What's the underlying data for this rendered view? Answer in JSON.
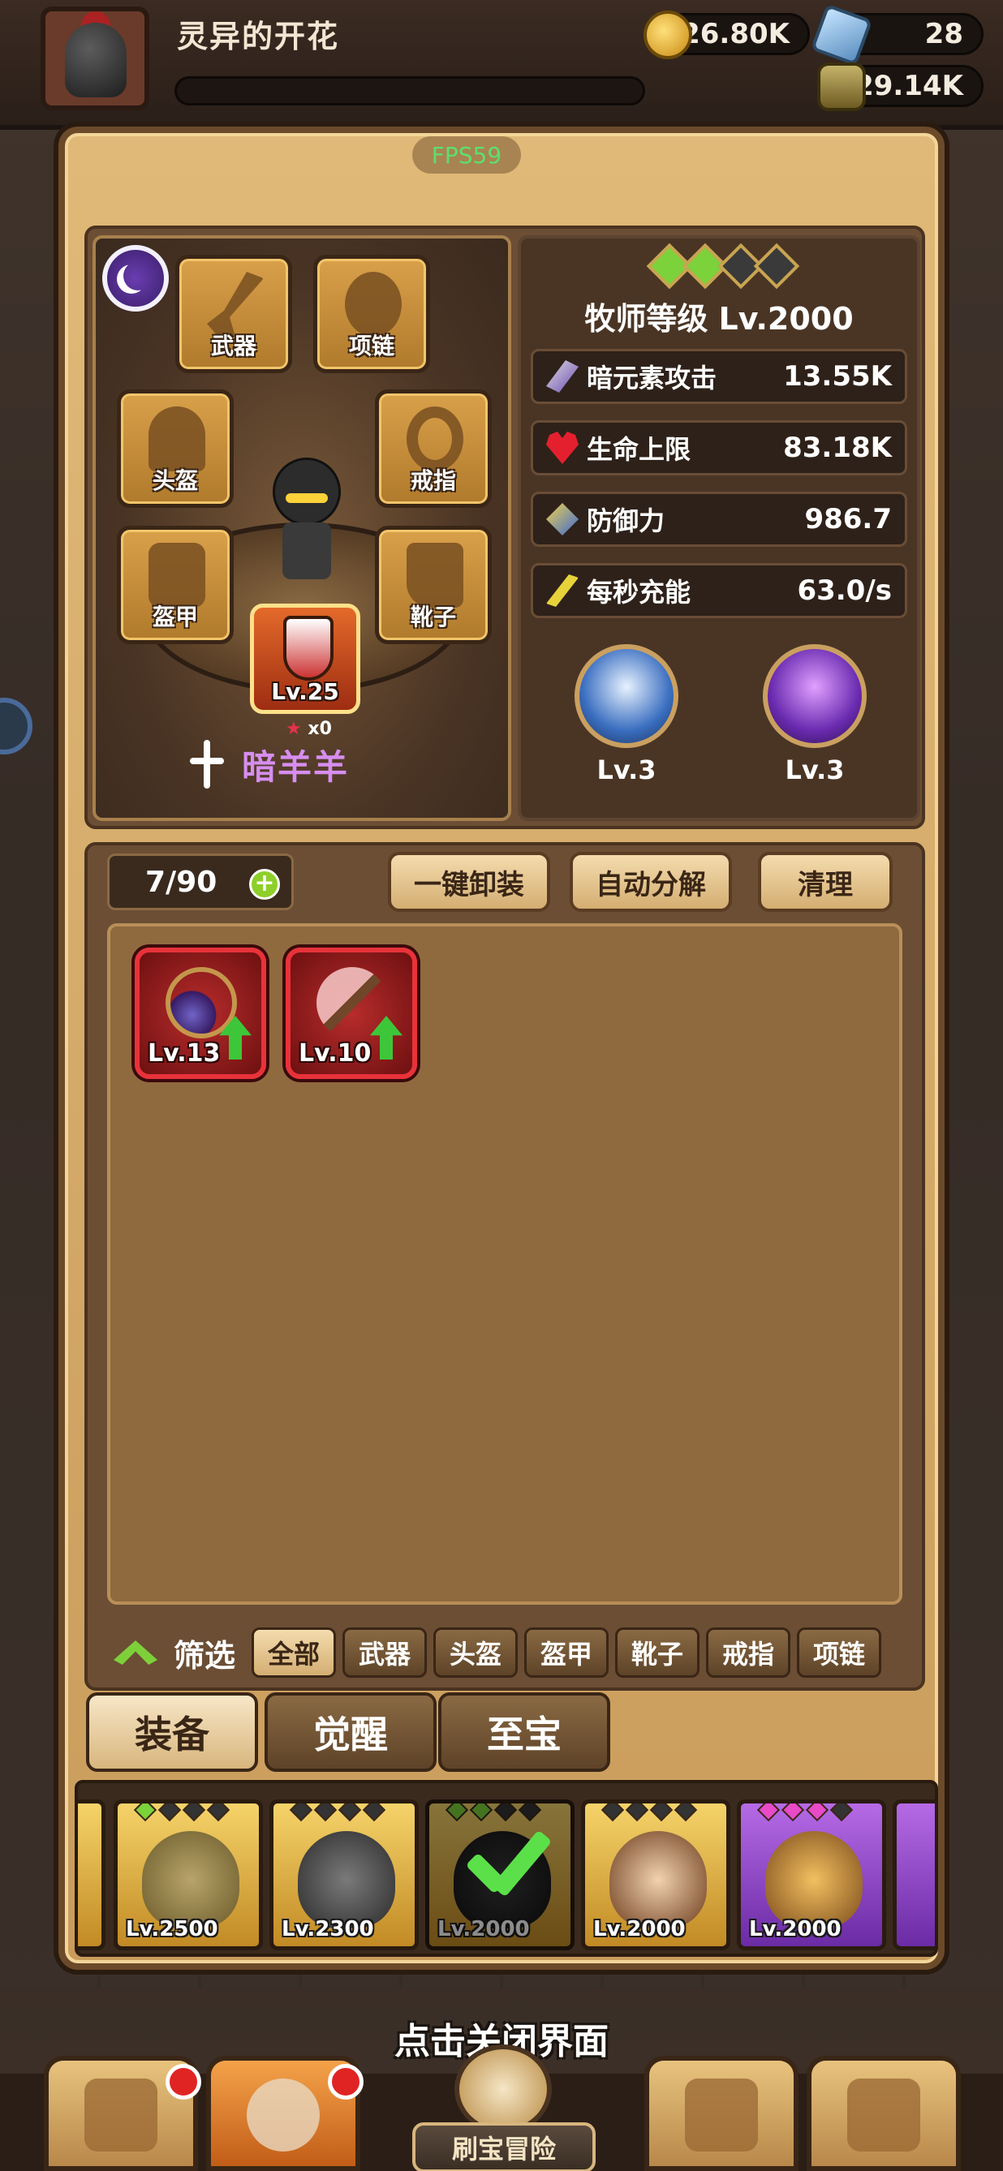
{
  "header": {
    "player_name": "灵异的开花",
    "gold": "126.80K",
    "gems": "28",
    "essence": "29.14K"
  },
  "fps": "FPS59",
  "equip_slots": {
    "weapon": "武器",
    "necklace": "项链",
    "helmet": "头盔",
    "ring": "戒指",
    "armor": "盔甲",
    "boots": "靴子"
  },
  "pet": {
    "level": "Lv.25",
    "stars": "x0"
  },
  "hero": {
    "name": "暗羊羊",
    "name_color": "#d68ef0",
    "class_level": "牧师等级 Lv.2000"
  },
  "stats": [
    {
      "label": "暗元素攻击",
      "value": "13.55K",
      "icon": "dark-attack-icon"
    },
    {
      "label": "生命上限",
      "value": "83.18K",
      "icon": "heart-icon"
    },
    {
      "label": "防御力",
      "value": "986.7",
      "icon": "defense-icon"
    },
    {
      "label": "每秒充能",
      "value": "63.0/s",
      "icon": "energy-icon"
    }
  ],
  "skills": [
    {
      "level": "Lv.3"
    },
    {
      "level": "Lv.3"
    }
  ],
  "inventory": {
    "capacity": "7/90",
    "buttons": [
      "一键卸装",
      "自动分解",
      "清理"
    ],
    "items": [
      {
        "level": "Lv.13",
        "art": "amulet-icon"
      },
      {
        "level": "Lv.10",
        "art": "staff-icon"
      }
    ],
    "filter_label": "筛选",
    "filters": [
      "全部",
      "武器",
      "头盔",
      "盔甲",
      "靴子",
      "戒指",
      "项链"
    ],
    "active_filter": "全部"
  },
  "tabs": [
    "装备",
    "觉醒",
    "至宝"
  ],
  "active_tab": "装备",
  "hero_roster": [
    {
      "level": "Lv.2500",
      "frame": "gold"
    },
    {
      "level": "Lv.2300",
      "frame": "gold"
    },
    {
      "level": "Lv.2000",
      "frame": "gold",
      "selected": true
    },
    {
      "level": "Lv.2000",
      "frame": "gold"
    },
    {
      "level": "Lv.2000",
      "frame": "purple"
    }
  ],
  "bottom_nav": {
    "close_hint": "点击关闭界面",
    "adventure_label": "刷宝冒险"
  }
}
